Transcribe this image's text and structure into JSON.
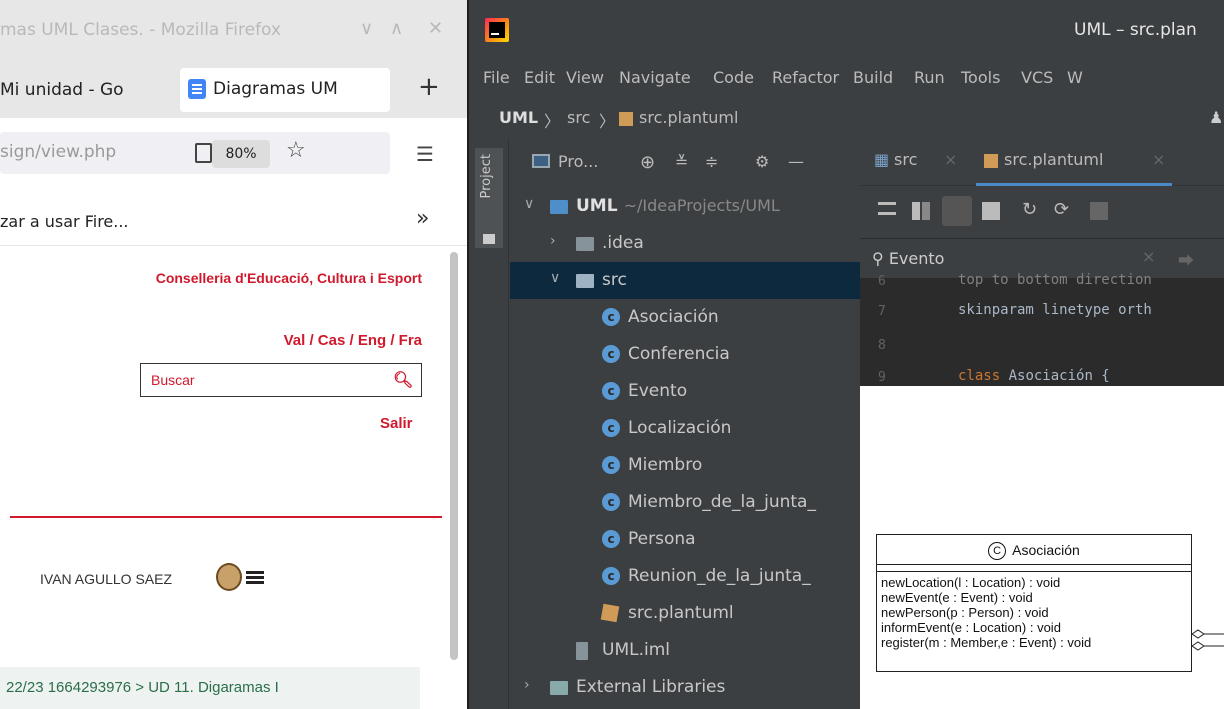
{
  "firefox": {
    "window_title": "mas UML Clases. - Mozilla Firefox",
    "tabs": [
      {
        "label": "Mi unidad - Go"
      },
      {
        "label": "Diagramas UM"
      }
    ],
    "url": "sign/view.php",
    "zoom": "80%",
    "bookmark": "zar a usar Fire...",
    "page": {
      "org": "Conselleria d'Educació, Cultura i Esport",
      "langs": "Val / Cas / Eng / Fra",
      "search_placeholder": "Buscar",
      "logout": "Salir",
      "user_name": "IVAN AGULLO SAEZ",
      "breadcrumb": "22/23 1664293976 > UD 11. Digaramas I"
    },
    "accent": "#d0192d"
  },
  "ide": {
    "window_title": "UML – src.plan",
    "menu": [
      "File",
      "Edit",
      "View",
      "Navigate",
      "Code",
      "Refactor",
      "Build",
      "Run",
      "Tools",
      "VCS",
      "W"
    ],
    "breadcrumb": [
      "UML",
      "src",
      "src.plantuml"
    ],
    "side_tab": "Project",
    "project_dropdown": "Pro...",
    "tree": [
      {
        "label": "UML",
        "sub": "~/IdeaProjects/UML"
      },
      {
        "label": ".idea"
      },
      {
        "label": "src"
      },
      {
        "label": "Asociación"
      },
      {
        "label": "Conferencia"
      },
      {
        "label": "Evento"
      },
      {
        "label": "Localización"
      },
      {
        "label": "Miembro"
      },
      {
        "label": "Miembro_de_la_junta_"
      },
      {
        "label": "Persona"
      },
      {
        "label": "Reunion_de_la_junta_"
      },
      {
        "label": "src.plantuml"
      },
      {
        "label": "UML.iml"
      },
      {
        "label": "External Libraries"
      }
    ],
    "editor_tabs": [
      {
        "label": "src"
      },
      {
        "label": "src.plantuml"
      }
    ],
    "find_text": "Evento",
    "code": [
      {
        "line": "6",
        "text": "top to bottom direction"
      },
      {
        "line": "7",
        "text": "skinparam linetype orth"
      },
      {
        "line": "8",
        "text": ""
      },
      {
        "line": "9",
        "kw": "class",
        "text": " Asociación {"
      }
    ],
    "uml": {
      "class_name": "Asociación",
      "stereo": "C",
      "methods": [
        "newLocation(l : Location) : void",
        "newEvent(e : Event) : void",
        "newPerson(p : Person) : void",
        "informEvent(e : Location) : void",
        "register(m : Member,e : Event) : void"
      ]
    }
  }
}
